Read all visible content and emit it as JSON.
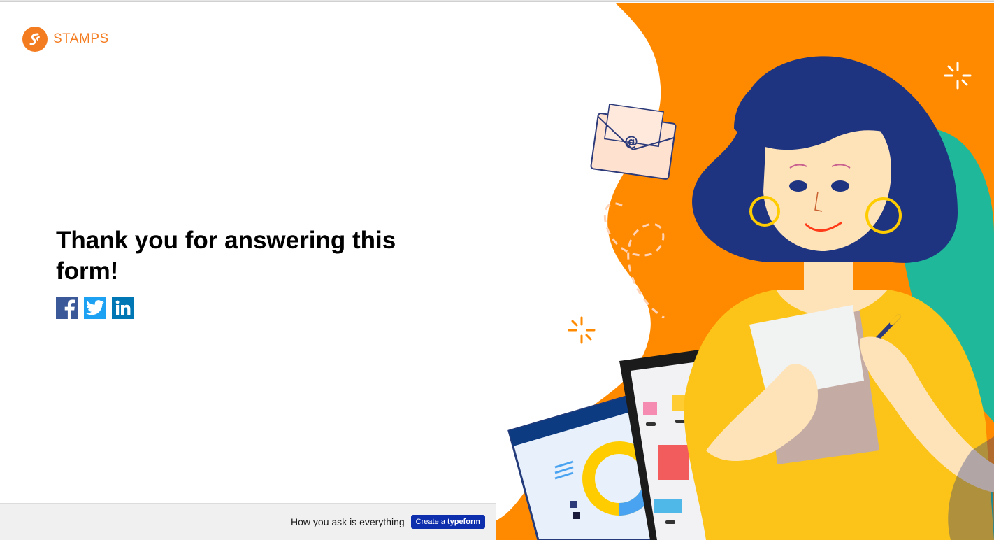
{
  "brand": {
    "name": "STAMPS",
    "logo_icon": "stamps-logo-icon",
    "color": "#f47c20"
  },
  "main": {
    "heading": "Thank you for answering this form!"
  },
  "social": [
    {
      "name": "facebook",
      "icon": "facebook-icon",
      "color": "#3b5998"
    },
    {
      "name": "twitter",
      "icon": "twitter-icon",
      "color": "#1da1f2"
    },
    {
      "name": "linkedin",
      "icon": "linkedin-icon",
      "color": "#0077b5"
    }
  ],
  "footer": {
    "tagline": "How you ask is everything",
    "create_prefix": "Create a",
    "create_brand": "typeform",
    "button_color": "#0e2fad"
  },
  "illustration": {
    "envelope_symbol": "@"
  }
}
